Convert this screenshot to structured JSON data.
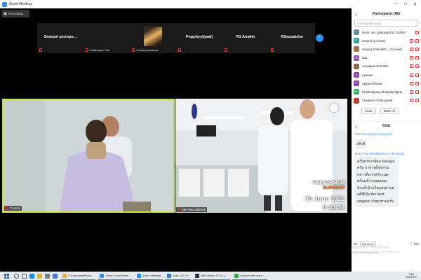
{
  "window": {
    "title": "Zoom Meeting"
  },
  "recording": {
    "label": "Recording..."
  },
  "thumbnails": [
    {
      "name": "Sompol permpo...",
      "sub": ""
    },
    {
      "name": "",
      "sub": "Naitthaysich kla"
    },
    {
      "name": "",
      "sub": "Surawej Numhom"
    },
    {
      "name": "Pupphyy(ipad)",
      "sub": ""
    },
    {
      "name": "R1 Amalin",
      "sub": ""
    },
    {
      "name": "R2supatcha",
      "sub": ""
    }
  ],
  "videos": {
    "left": {
      "label": "Control"
    },
    "right": {
      "label": "Ekk Ramathibodi",
      "brand1": "RAMATHIBODI",
      "brand2": "SURGERY",
      "date": "30 June 2021",
      "time": "8:53:36"
    }
  },
  "participants": {
    "title": "Participants (86)",
    "search_placeholder": "Find a participant",
    "items": [
      {
        "initial": "",
        "name": "(Host, me, participant ID: 21834)",
        "color": "#6b8e9e"
      },
      {
        "initial": "C",
        "name": "Control (Co-host)",
        "color": "#2aa198"
      },
      {
        "initial": "",
        "name": "Surgery Ramathib... (Co-host)",
        "color": "#a07050"
      },
      {
        "initial": "A",
        "name": "aaa",
        "color": "#9b59b6"
      },
      {
        "initial": "",
        "name": "Ampaipan Boonthai",
        "color": "#8a6a4a"
      },
      {
        "initial": "A",
        "name": "Apawee",
        "color": "#8e44ad"
      },
      {
        "initial": "A",
        "name": "Apiput Dhirakul",
        "color": "#8e44ad"
      },
      {
        "initial": "CC",
        "name": "Chalermpong Chatdokmaiprai",
        "color": "#27ae60"
      },
      {
        "initial": "",
        "name": "Chewinter Pattanapitat",
        "color": "#c0392b"
      }
    ],
    "invite_label": "Invite",
    "mute_all_label": "Mute All"
  },
  "chat": {
    "title": "Chat",
    "msg1": {
      "from": "From",
      "sender": "Limegang",
      "to": "to Everyone",
      "text": "เช้าดี"
    },
    "msg2": {
      "from": "From",
      "sender": "Pisa Samakkarlove",
      "to": "to Everyone",
      "text": "ครับอาจารย์ผม ขอบคุณครับ อาจารย์ทุกท่านกล่าวดีมากครับ และพร้อมจำเก่งสุดยอดประจำบ้านในแพ่งผ่านอ่อดีที่เป็น the best surgeon กับทุกท่านครับ"
    },
    "to_label": "To:",
    "to_value": "Everyone",
    "file_label": "File",
    "input_placeholder": "Type message here..."
  },
  "activation": {
    "line1": "Activate Windows",
    "line2": "Go to Settings to activate Windows."
  },
  "taskbar": {
    "apps": [
      {
        "label": "C:\\Users\\km\\Pictur...",
        "color": "#e0b030"
      },
      {
        "label": "Zoom Cloud Meeti...",
        "color": "#2d8cff"
      },
      {
        "label": "Zoom Meeting",
        "color": "#2d8cff"
      },
      {
        "label": "Stat 1.12.7.0",
        "color": "#3a7bd5"
      },
      {
        "label": "OBS Studio 27.0.1 (...",
        "color": "#333333"
      },
      {
        "label": "connect with out a ...",
        "color": "#34a853"
      }
    ],
    "time": "8:53",
    "date": "30/6/2021"
  }
}
